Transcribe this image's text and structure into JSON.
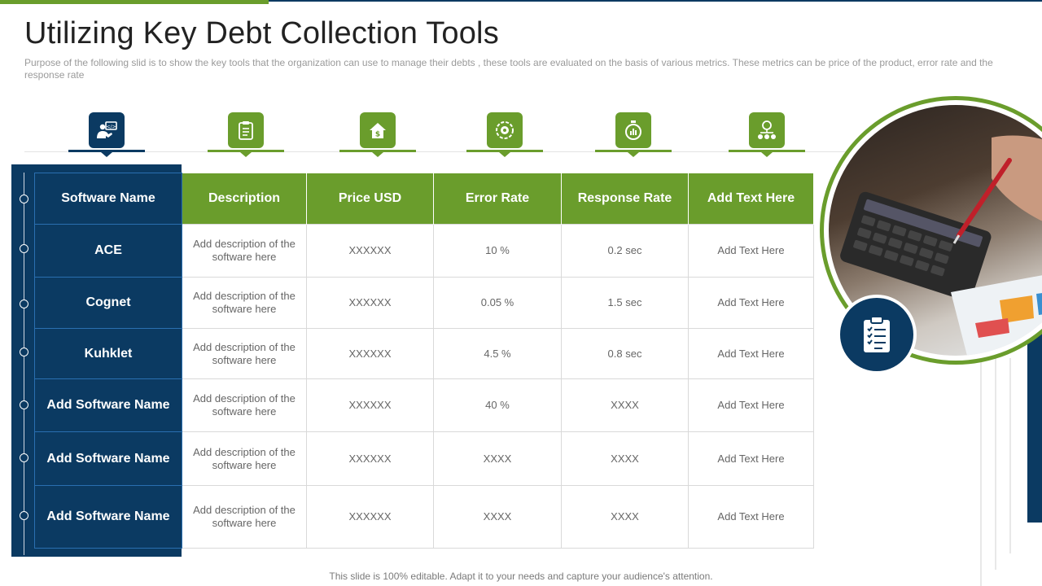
{
  "slide": {
    "title": "Utilizing Key Debt Collection Tools",
    "subtitle": "Purpose of the following slid is to show the key tools that the organization can use to manage their debts , these tools are evaluated on the basis of various metrics. These metrics can be price of the product, error rate and the response rate",
    "footer": "This slide is 100% editable. Adapt it to your needs and capture your audience's attention."
  },
  "icons": [
    "software-developer-icon",
    "clipboard-icon",
    "price-house-icon",
    "error-gear-icon",
    "response-timer-icon",
    "network-hierarchy-icon"
  ],
  "colors": {
    "navy": "#0b3a62",
    "green": "#6a9d2c",
    "grid": "#d9d9d9"
  },
  "table": {
    "headers": [
      "Software Name",
      "Description",
      "Price USD",
      "Error Rate",
      "Response Rate",
      "Add Text Here"
    ],
    "rows": [
      {
        "name": "ACE",
        "description": "Add description of the software here",
        "price": "XXXXXX",
        "error": "10 %",
        "response": "0.2 sec",
        "extra": "Add Text Here"
      },
      {
        "name": "Cognet",
        "description": "Add description of the software here",
        "price": "XXXXXX",
        "error": "0.05 %",
        "response": "1.5 sec",
        "extra": "Add Text Here"
      },
      {
        "name": "Kuhklet",
        "description": "Add description of the software here",
        "price": "XXXXXX",
        "error": "4.5 %",
        "response": "0.8 sec",
        "extra": "Add Text Here"
      },
      {
        "name": "Add Software Name",
        "description": "Add description of the software here",
        "price": "XXXXXX",
        "error": "40 %",
        "response": "XXXX",
        "extra": "Add Text Here"
      },
      {
        "name": "Add Software Name",
        "description": "Add description of the software here",
        "price": "XXXXXX",
        "error": "XXXX",
        "response": "XXXX",
        "extra": "Add Text Here"
      },
      {
        "name": "Add Software Name",
        "description": "Add description of the software here",
        "price": "XXXXXX",
        "error": "XXXX",
        "response": "XXXX",
        "extra": "Add Text Here"
      }
    ]
  }
}
